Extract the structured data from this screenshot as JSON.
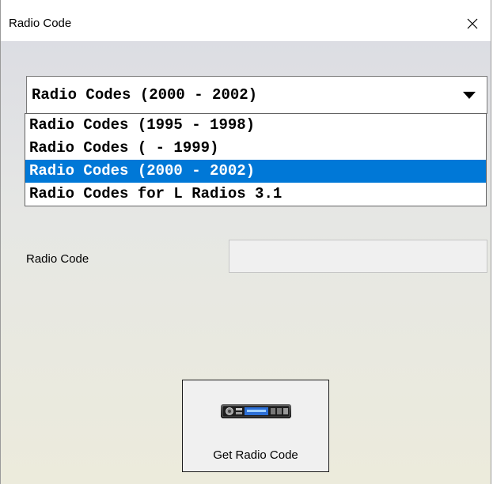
{
  "window": {
    "title": "Radio Code"
  },
  "combo": {
    "selected": "Radio Codes (2000 - 2002)",
    "options": [
      "Radio Codes (1995 - 1998)",
      "Radio Codes ( - 1999)",
      "Radio Codes (2000 - 2002)",
      "Radio Codes for L Radios 3.1"
    ],
    "selected_index": 2
  },
  "radio_code": {
    "label": "Radio Code",
    "value": ""
  },
  "button": {
    "label": "Get Radio Code",
    "icon": "car-radio-icon"
  },
  "colors": {
    "selection": "#0078d7",
    "title_bg": "#ffffff",
    "field_bg": "#f0f0f0"
  },
  "icons": {
    "close": "close-icon",
    "dropdown": "chevron-down-icon",
    "radio": "car-radio-icon"
  }
}
